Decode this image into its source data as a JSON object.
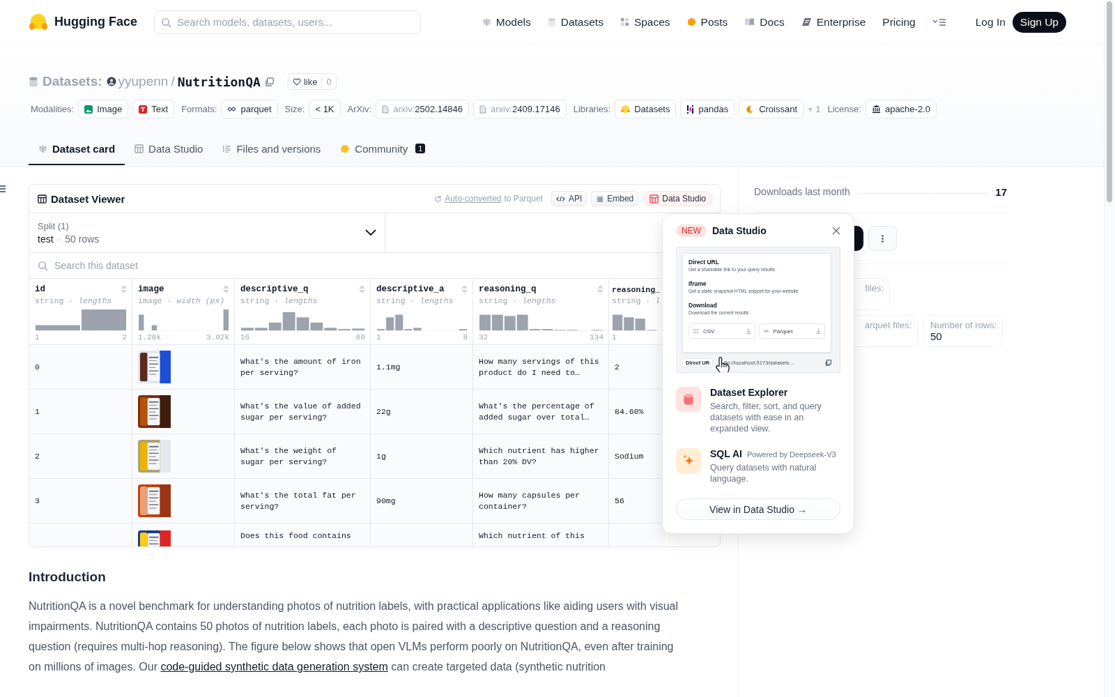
{
  "nav": {
    "brand": "Hugging Face",
    "search": {
      "placeholder": "Search models, datasets, users..."
    },
    "links": [
      {
        "label": "Models"
      },
      {
        "label": "Datasets"
      },
      {
        "label": "Spaces"
      },
      {
        "label": "Posts"
      },
      {
        "label": "Docs"
      },
      {
        "label": "Enterprise"
      },
      {
        "label": "Pricing"
      }
    ],
    "login": "Log In",
    "signup": "Sign Up"
  },
  "repo": {
    "type": "Datasets:",
    "owner": "yyupenn",
    "separator": "/",
    "name": "NutritionQA",
    "like": "like",
    "likes": "0",
    "tags": [
      {
        "kind": "label",
        "text": "Modalities:"
      },
      {
        "kind": "tag",
        "text": "Image"
      },
      {
        "kind": "tag",
        "text": "Text"
      },
      {
        "kind": "label",
        "text": "Formats:"
      },
      {
        "kind": "tag",
        "text": "parquet"
      },
      {
        "kind": "label",
        "text": "Size:"
      },
      {
        "kind": "tag",
        "text": "< 1K"
      },
      {
        "kind": "label",
        "text": "ArXiv:"
      },
      {
        "kind": "tag",
        "prefix": "arxiv:",
        "text": "2502.14846"
      },
      {
        "kind": "tag",
        "prefix": "arxiv:",
        "text": "2409.17146"
      },
      {
        "kind": "label",
        "text": "Libraries:"
      },
      {
        "kind": "tag",
        "text": "Datasets"
      },
      {
        "kind": "tag",
        "text": "pandas"
      },
      {
        "kind": "tag",
        "text": "Croissant"
      },
      {
        "kind": "more",
        "text": "+ 1"
      },
      {
        "kind": "label",
        "text": "License:"
      },
      {
        "kind": "tag",
        "text": "apache-2.0"
      }
    ]
  },
  "tabs": [
    {
      "label": "Dataset card",
      "selected": true
    },
    {
      "label": "Data Studio",
      "selected": false
    },
    {
      "label": "Files and versions",
      "selected": false
    },
    {
      "label": "Community",
      "badge": "1",
      "selected": false
    }
  ],
  "viewer": {
    "title": "Dataset Viewer",
    "converted_link": "Auto-converted",
    "converted_text": "to Parquet",
    "buttons": [
      {
        "label": "API",
        "selected": false
      },
      {
        "label": "Embed",
        "selected": false
      },
      {
        "label": "Data Studio",
        "selected": true
      }
    ],
    "split": {
      "label": "Split (1)",
      "name": "test",
      "separator": "·",
      "rows": "50 rows"
    },
    "search": {
      "placeholder": "Search this dataset"
    },
    "columns": [
      {
        "name": "id",
        "type": "string",
        "separator": "·",
        "stat": "lengths",
        "min": "1",
        "max": "2",
        "sortable": true
      },
      {
        "name": "image",
        "type": "image",
        "separator": "·",
        "stat": "width (px)",
        "min": "1.28k",
        "max": "3.02k",
        "sortable": true
      },
      {
        "name": "descriptive_q",
        "type": "string",
        "separator": "·",
        "stat": "lengths",
        "min": "16",
        "max": "60",
        "sortable": true
      },
      {
        "name": "descriptive_a",
        "type": "string",
        "separator": "·",
        "stat": "lengths",
        "min": "1",
        "max": "8",
        "sortable": true
      },
      {
        "name": "reasoning_q",
        "type": "string",
        "separator": "·",
        "stat": "lengths",
        "min": "32",
        "max": "134",
        "sortable": true
      },
      {
        "name": "reasoning_",
        "type": "string",
        "separator": "·",
        "stat": "l",
        "min": "1",
        "sortable": false
      }
    ],
    "rows": [
      {
        "cells": [
          "0",
          {
            "kind": "picture"
          },
          "What's the amount of iron per serving?",
          "1.1mg",
          "How many servings of this product do I need to…",
          "2"
        ]
      },
      {
        "cells": [
          "1",
          {
            "kind": "picture"
          },
          "What's the value of added sugar per serving?",
          "22g",
          "What's the percentage of added sugar over total…",
          "84.60%"
        ]
      },
      {
        "cells": [
          "2",
          {
            "kind": "picture"
          },
          "What's the weight of sugar per serving?",
          "1g",
          "Which nutrient has higher than 20% DV?",
          "Sodium"
        ]
      },
      {
        "cells": [
          "3",
          {
            "kind": "picture"
          },
          "What's the total fat per serving?",
          "90mg",
          "How many capsules per container?",
          "56"
        ]
      },
      {
        "cells": [
          null,
          {
            "kind": "picture"
          },
          "Does this food contains",
          null,
          "Which nutrient of this",
          null
        ]
      }
    ]
  },
  "popover": {
    "badge": "NEW",
    "title": "Data Studio",
    "preview": {
      "sections": [
        {
          "title": "Direct URL",
          "text": "Get a shareable link to your query results"
        },
        {
          "title": "Iframe",
          "text": "Get a static snapshot HTML snippet for your website"
        },
        {
          "title": "Download",
          "text": "Download the current results"
        }
      ],
      "formats": [
        "CSV",
        "Parquet"
      ],
      "url_label": "Direct UR",
      "url": "ttp://localhost:5173/datasets…"
    },
    "features": [
      {
        "title": "Dataset Explorer",
        "text": "Search, filter, sort, and query datasets with ease in an expanded view."
      },
      {
        "title": "SQL AI",
        "note": "Powered by Deepseek-V3",
        "text": "Query datasets with natural language."
      }
    ],
    "button": "View in Data Studio →"
  },
  "sidebar": {
    "downloads_label": "Downloads last month",
    "downloads": "17",
    "cards": [
      {
        "label": "files:"
      },
      {
        "label": "arquet files:"
      },
      {
        "label": "Number of rows:",
        "value": "50"
      }
    ]
  },
  "card": {
    "heading": "Introduction",
    "paragraph": {
      "before": "NutritionQA is a novel benchmark for understanding photos of nutrition labels, with practical applications like aiding users with visual impairments. NutritionQA contains 50 photos of nutrition labels, each photo is paired with a descriptive question and a reasoning question (requires multi-hop reasoning). The figure below shows that open VLMs perform poorly on NutritionQA, even after training on millions of images. Our ",
      "link": "code-guided synthetic data generation system",
      "after": " can create targeted data (synthetic nutrition"
    }
  }
}
